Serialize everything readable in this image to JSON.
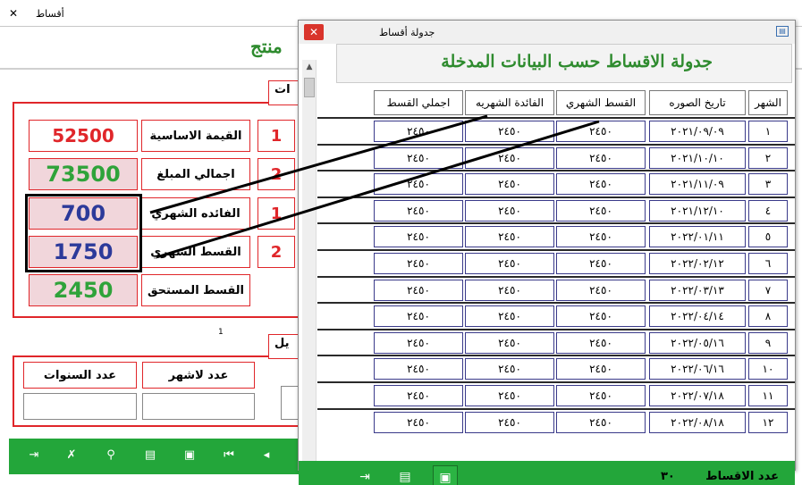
{
  "background_window": {
    "title": "أقساط",
    "main_title": "منتج",
    "section1_label": "ات",
    "fields": {
      "base_value_label": "القيمة الاساسية",
      "base_value": "52500",
      "total_label": "اجمالي المبلغ",
      "total": "73500",
      "monthly_interest_label": "الفائده الشهري",
      "monthly_interest": "700",
      "monthly_installment_label": "القسط الشهري",
      "monthly_installment": "1750",
      "due_installment_label": "القسط المستحق",
      "due_installment": "2450",
      "digit1": "1",
      "digit2": "2",
      "digit3": "1",
      "digit4": "2"
    },
    "page_num": "1",
    "section2_label": "يل",
    "months_count_label": "عدد لاشهر",
    "years_count_label": "عدد السنوات"
  },
  "foreground_window": {
    "title": "جدولة أقساط",
    "heading": "جدولة الاقساط حسب البيانات المدخلة",
    "columns": [
      "الشهر",
      "تاريخ الصوره",
      "القسط الشهري",
      "الفائدة الشهريه",
      "اجملي القسط"
    ],
    "rows": [
      {
        "month": "١",
        "date": "٢٠٢١/٠٩/٠٩",
        "installment": "٢٤٥٠",
        "interest": "٢٤٥٠",
        "total": "٢٤٥٠"
      },
      {
        "month": "٢",
        "date": "٢٠٢١/١٠/١٠",
        "installment": "٢٤٥٠",
        "interest": "٢٤٥٠",
        "total": "٢٤٥٠"
      },
      {
        "month": "٣",
        "date": "٢٠٢١/١١/٠٩",
        "installment": "٢٤٥٠",
        "interest": "٢٤٥٠",
        "total": "٢٤٥٠"
      },
      {
        "month": "٤",
        "date": "٢٠٢١/١٢/١٠",
        "installment": "٢٤٥٠",
        "interest": "٢٤٥٠",
        "total": "٢٤٥٠"
      },
      {
        "month": "٥",
        "date": "٢٠٢٢/٠١/١١",
        "installment": "٢٤٥٠",
        "interest": "٢٤٥٠",
        "total": "٢٤٥٠"
      },
      {
        "month": "٦",
        "date": "٢٠٢٢/٠٢/١٢",
        "installment": "٢٤٥٠",
        "interest": "٢٤٥٠",
        "total": "٢٤٥٠"
      },
      {
        "month": "٧",
        "date": "٢٠٢٢/٠٣/١٣",
        "installment": "٢٤٥٠",
        "interest": "٢٤٥٠",
        "total": "٢٤٥٠"
      },
      {
        "month": "٨",
        "date": "٢٠٢٢/٠٤/١٤",
        "installment": "٢٤٥٠",
        "interest": "٢٤٥٠",
        "total": "٢٤٥٠"
      },
      {
        "month": "٩",
        "date": "٢٠٢٢/٠٥/١٦",
        "installment": "٢٤٥٠",
        "interest": "٢٤٥٠",
        "total": "٢٤٥٠"
      },
      {
        "month": "١٠",
        "date": "٢٠٢٢/٠٦/١٦",
        "installment": "٢٤٥٠",
        "interest": "٢٤٥٠",
        "total": "٢٤٥٠"
      },
      {
        "month": "١١",
        "date": "٢٠٢٢/٠٧/١٨",
        "installment": "٢٤٥٠",
        "interest": "٢٤٥٠",
        "total": "٢٤٥٠"
      },
      {
        "month": "١٢",
        "date": "٢٠٢٢/٠٨/١٨",
        "installment": "٢٤٥٠",
        "interest": "٢٤٥٠",
        "total": "٢٤٥٠"
      }
    ],
    "footer_label": "عدد الاقساط",
    "footer_count": "٣٠"
  },
  "colors": {
    "accent_green": "#23a63a",
    "border_red": "#e0262a",
    "value_red": "#e0262a",
    "value_green": "#2fa33a",
    "value_blue": "#2c3a9a",
    "highlight_bg": "#f1d6db"
  },
  "icons": [
    "close-icon",
    "window-icon",
    "exit-icon",
    "print-icon",
    "save-icon",
    "delete-icon",
    "search-icon",
    "first-record-icon",
    "prev-record-icon"
  ]
}
